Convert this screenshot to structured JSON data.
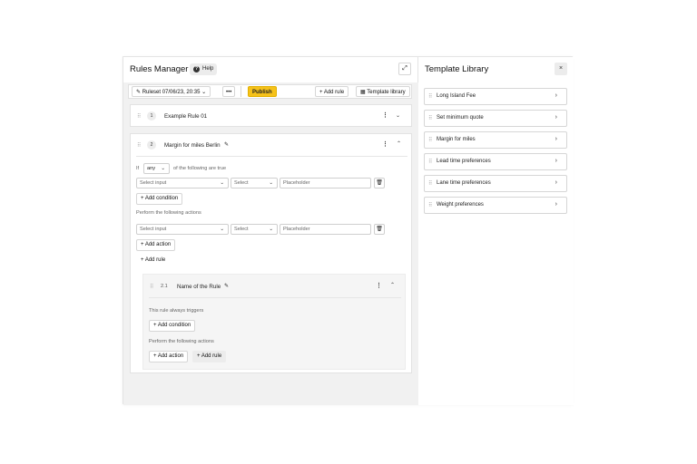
{
  "left": {
    "title": "Rules Manager",
    "help_label": "Help",
    "expand_icon": "⤢",
    "toolbar": {
      "ruleset_label": "Ruleset 07/06/23, 20:35",
      "more_label": "•••",
      "publish_label": "Publish",
      "add_rule_label": "+ Add rule",
      "template_library_label": "Template library"
    },
    "rule1": {
      "number": "1",
      "name": "Example Rule 01"
    },
    "rule2": {
      "number": "2",
      "name": "Margin for miles Berlin",
      "if_label": "If",
      "any_value": "any",
      "following_text": "of the following are true",
      "condition_row": {
        "input_placeholder": "Select input",
        "select_placeholder": "Select",
        "value_placeholder": "Placeholder"
      },
      "add_condition_label": "+ Add condition",
      "perform_text": "Perform the following actions",
      "action_row": {
        "input_placeholder": "Select input",
        "select_placeholder": "Select",
        "value_placeholder": "Placeholder"
      },
      "add_action_label": "+ Add action",
      "add_rule_label": "+ Add rule"
    },
    "rule21": {
      "number": "2.1",
      "name": "Name of the Rule",
      "always_text": "This rule always triggers",
      "add_condition_label": "+ Add condition",
      "perform_text": "Perform the following actions",
      "add_action_label": "+ Add action",
      "add_rule_label": "+ Add rule"
    }
  },
  "right": {
    "title": "Template Library",
    "close_label": "×",
    "items": [
      {
        "label": "Long Island Fee"
      },
      {
        "label": "Set minimum quote"
      },
      {
        "label": "Margin for miles"
      },
      {
        "label": "Lead time preferences"
      },
      {
        "label": "Lane time preferences"
      },
      {
        "label": "Weight preferences"
      }
    ]
  },
  "colors": {
    "accent": "#f6c21a",
    "panel_bg": "#f1f1f1",
    "border": "#e2e2e2"
  }
}
